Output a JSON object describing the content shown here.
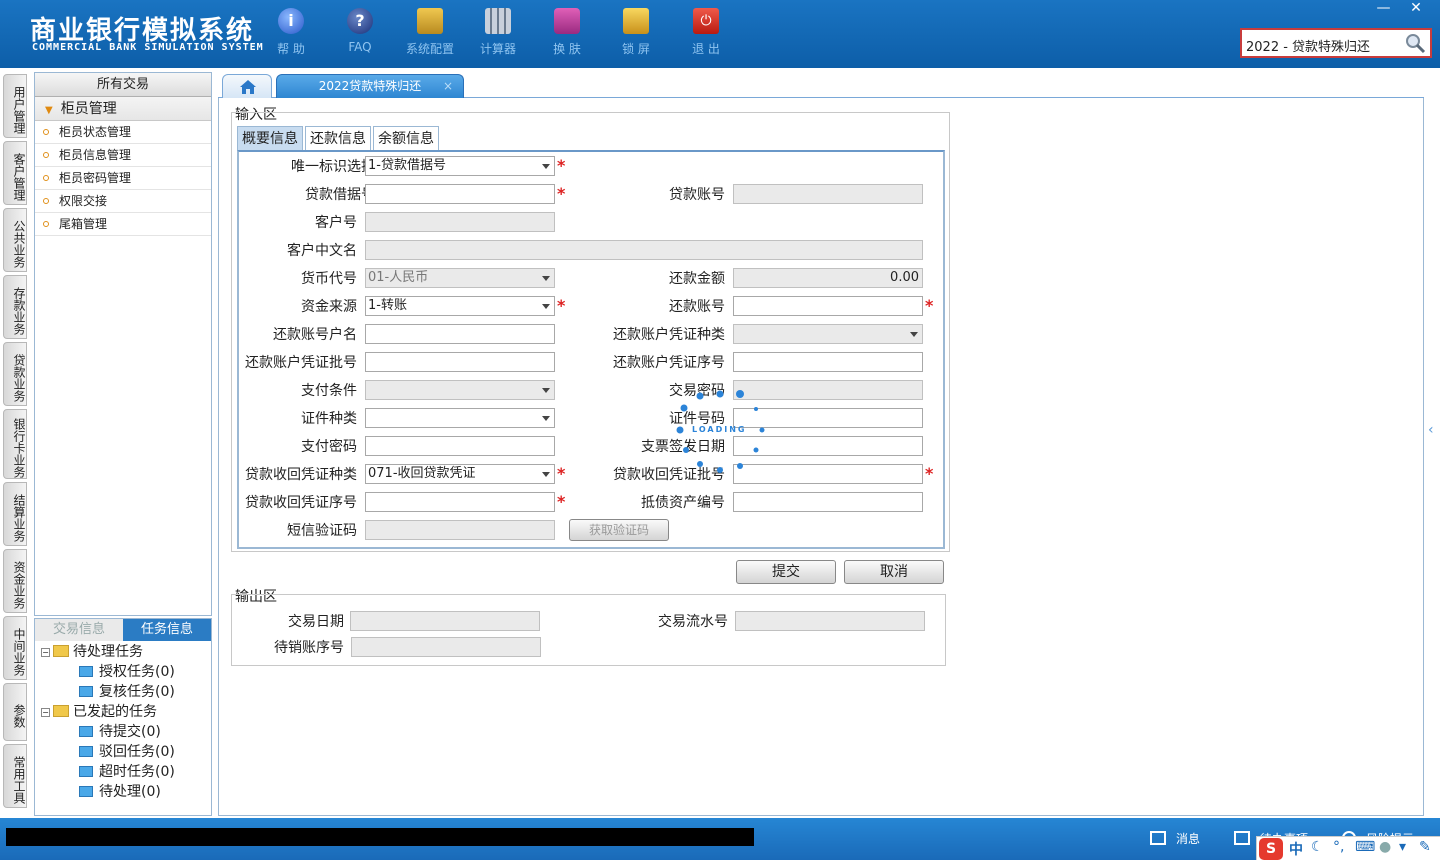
{
  "header": {
    "brand_cn": "商业银行模拟系统",
    "brand_en": "COMMERCIAL BANK SIMULATION SYSTEM",
    "toolbar": [
      {
        "label": "帮 助",
        "icon": "info-icon",
        "color": "#3a6fd8"
      },
      {
        "label": "FAQ",
        "icon": "help-icon",
        "color": "#2a4fa8"
      },
      {
        "label": "系统配置",
        "icon": "toolbox-icon",
        "color": "#e0b040"
      },
      {
        "label": "计算器",
        "icon": "calculator-icon",
        "color": "#8a9ab0"
      },
      {
        "label": "换 肤",
        "icon": "shirt-icon",
        "color": "#d050a8"
      },
      {
        "label": "锁 屏",
        "icon": "lock-icon",
        "color": "#e8b830"
      },
      {
        "label": "退 出",
        "icon": "power-icon",
        "color": "#d83a2a"
      }
    ],
    "window_controls": {
      "minimize": "—",
      "close": "✕"
    },
    "search_value": "2022 - 贷款特殊归还"
  },
  "left_tabs": [
    "用户管理",
    "客户管理",
    "公共业务",
    "存款业务",
    "贷款业务",
    "银行卡业务",
    "结算业务",
    "资金业务",
    "中间业务",
    "参数",
    "常用工具"
  ],
  "tree": {
    "header": "所有交易",
    "group": "柜员管理",
    "items": [
      "柜员状态管理",
      "柜员信息管理",
      "柜员密码管理",
      "权限交接",
      "尾箱管理"
    ]
  },
  "task_panel": {
    "tabs": [
      "交易信息",
      "任务信息"
    ],
    "pending": {
      "label": "待处理任务",
      "children": [
        "授权任务(0)",
        "复核任务(0)"
      ]
    },
    "initiated": {
      "label": "已发起的任务",
      "children": [
        "待提交(0)",
        "驳回任务(0)",
        "超时任务(0)",
        "待处理(0)"
      ]
    }
  },
  "tabs": {
    "active": "2022贷款特殊归还",
    "close": "×"
  },
  "input_section": {
    "title": "输入区",
    "form_tabs": [
      "概要信息",
      "还款信息",
      "余额信息"
    ],
    "fields": {
      "unique_id": {
        "label": "唯一标识选择",
        "value": "1-贷款借据号"
      },
      "loan_receipt_no": {
        "label": "贷款借据号",
        "value": ""
      },
      "loan_account": {
        "label": "贷款账号",
        "value": ""
      },
      "customer_no": {
        "label": "客户号",
        "value": ""
      },
      "customer_name_cn": {
        "label": "客户中文名",
        "value": ""
      },
      "currency": {
        "label": "货币代号",
        "value": "01-人民币"
      },
      "repay_amount": {
        "label": "还款金额",
        "value": "0.00"
      },
      "fund_source": {
        "label": "资金来源",
        "value": "1-转账"
      },
      "repay_account": {
        "label": "还款账号",
        "value": ""
      },
      "repay_account_name": {
        "label": "还款账号户名",
        "value": ""
      },
      "repay_voucher_type": {
        "label": "还款账户凭证种类",
        "value": ""
      },
      "repay_voucher_batch": {
        "label": "还款账户凭证批号",
        "value": ""
      },
      "repay_voucher_seq": {
        "label": "还款账户凭证序号",
        "value": ""
      },
      "pay_condition": {
        "label": "支付条件",
        "value": ""
      },
      "tx_password": {
        "label": "交易密码",
        "value": ""
      },
      "id_type": {
        "label": "证件种类",
        "value": ""
      },
      "id_number": {
        "label": "证件号码",
        "value": ""
      },
      "pay_password": {
        "label": "支付密码",
        "value": ""
      },
      "check_issue_date": {
        "label": "支票签发日期",
        "value": ""
      },
      "recovery_voucher_type": {
        "label": "贷款收回凭证种类",
        "value": "071-收回贷款凭证"
      },
      "recovery_voucher_batch": {
        "label": "贷款收回凭证批号",
        "value": ""
      },
      "recovery_voucher_seq": {
        "label": "贷款收回凭证序号",
        "value": ""
      },
      "debt_asset_no": {
        "label": "抵债资产编号",
        "value": ""
      },
      "sms_code": {
        "label": "短信验证码",
        "value": ""
      }
    },
    "get_code_button": "获取验证码",
    "required_mark": "*",
    "loading_text": "LOADING"
  },
  "actions": {
    "submit": "提交",
    "cancel": "取消"
  },
  "output_section": {
    "title": "输出区",
    "tx_date": {
      "label": "交易日期",
      "value": ""
    },
    "tx_serial": {
      "label": "交易流水号",
      "value": ""
    },
    "pending_account_seq": {
      "label": "待销账序号",
      "value": ""
    }
  },
  "statusbar": {
    "message": "消息",
    "todo": "待办事项",
    "risk": "风险提示"
  },
  "ime": {
    "logo": "S",
    "mode": "中"
  }
}
